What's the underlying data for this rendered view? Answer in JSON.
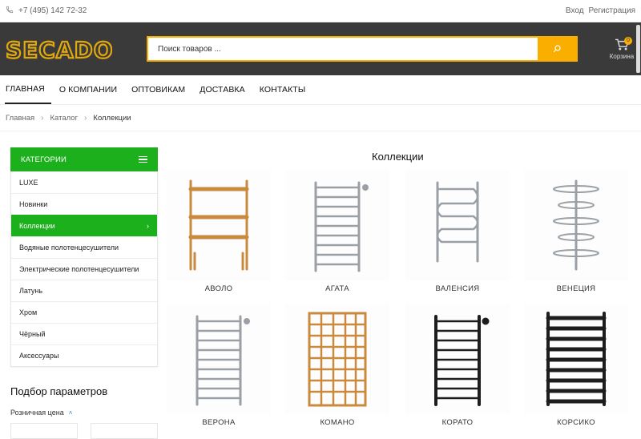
{
  "topbar": {
    "phone": "+7 (495) 142 72-32",
    "login": "Вход",
    "register": "Регистрация"
  },
  "header": {
    "logo_text": "SECADO",
    "search_placeholder": "Поиск товаров ...",
    "cart_label": "Корзина",
    "cart_count": "0",
    "accent_color": "#f9ae00"
  },
  "nav": {
    "items": [
      "ГЛАВНАЯ",
      "О КОМПАНИИ",
      "ОПТОВИКАМ",
      "ДОСТАВКА",
      "КОНТАКТЫ"
    ]
  },
  "breadcrumb": {
    "items": [
      "Главная",
      "Каталог",
      "Коллекции"
    ]
  },
  "sidebar": {
    "header": "КАТЕГОРИИ",
    "accent_color": "#1db01d",
    "items": [
      "LUXE",
      "Новинки",
      "Коллекции",
      "Водяные полотенцесушители",
      "Электрические полотенцесушители",
      "Латунь",
      "Хром",
      "Чёрный",
      "Аксессуары"
    ],
    "active_item": "Коллекции",
    "filter_title": "Подбор параметров",
    "price_label": "Розничная цена"
  },
  "main": {
    "title": "Коллекции",
    "products": [
      {
        "name": "АВОЛО",
        "finish": "copper",
        "style": "ladder-feet"
      },
      {
        "name": "АГАТА",
        "finish": "chrome",
        "style": "ladder-side"
      },
      {
        "name": "ВАЛЕНСИЯ",
        "finish": "chrome",
        "style": "serpentine"
      },
      {
        "name": "ВЕНЕЦИЯ",
        "finish": "chrome",
        "style": "center-hooks"
      },
      {
        "name": "ВЕРОНА",
        "finish": "chrome",
        "style": "ladder-side"
      },
      {
        "name": "КОМАНО",
        "finish": "copper",
        "style": "grid"
      },
      {
        "name": "КОРАТО",
        "finish": "black",
        "style": "ladder-side"
      },
      {
        "name": "КОРСИКО",
        "finish": "black",
        "style": "frame-wide"
      }
    ]
  }
}
